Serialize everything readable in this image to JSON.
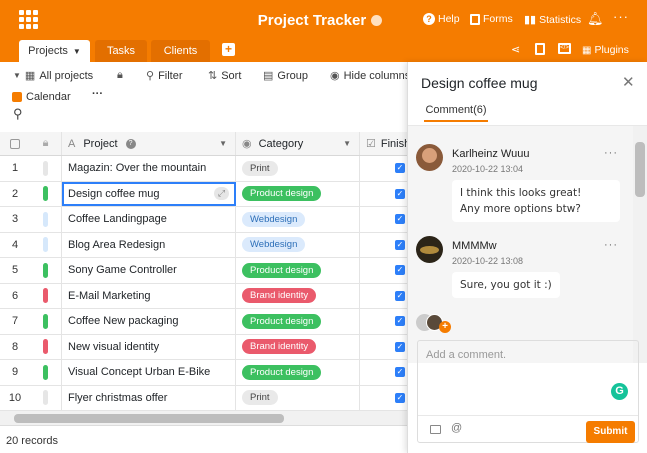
{
  "header": {
    "title": "Project Tracker",
    "help": "Help",
    "forms": "Forms",
    "statistics": "Statistics",
    "plugins": "Plugins"
  },
  "tabs": [
    {
      "label": "Projects",
      "active": true
    },
    {
      "label": "Tasks"
    },
    {
      "label": "Clients"
    }
  ],
  "toolbar": {
    "view": "All projects",
    "filter": "Filter",
    "sort": "Sort",
    "group": "Group",
    "hide": "Hide columns",
    "calendar": "Calendar",
    "more": "···"
  },
  "columns": {
    "project": "Project",
    "category": "Category",
    "finished": "Finished"
  },
  "rows": [
    {
      "n": "1",
      "name": "Magazin: Over the mountain",
      "cat": "Print",
      "bar": "#e6e6e6"
    },
    {
      "n": "2",
      "name": "Design coffee mug",
      "cat": "Product design",
      "bar": "#3cc060"
    },
    {
      "n": "3",
      "name": "Coffee Landingpage",
      "cat": "Webdesign",
      "bar": "#d6e8fb"
    },
    {
      "n": "4",
      "name": "Blog Area Redesign",
      "cat": "Webdesign",
      "bar": "#d6e8fb"
    },
    {
      "n": "5",
      "name": "Sony Game Controller",
      "cat": "Product design",
      "bar": "#3cc060"
    },
    {
      "n": "6",
      "name": "E-Mail Marketing",
      "cat": "Brand identity",
      "bar": "#ea5a6c"
    },
    {
      "n": "7",
      "name": "Coffee New packaging",
      "cat": "Product design",
      "bar": "#3cc060"
    },
    {
      "n": "8",
      "name": "New visual identity",
      "cat": "Brand identity",
      "bar": "#ea5a6c"
    },
    {
      "n": "9",
      "name": "Visual Concept Urban E-Bike",
      "cat": "Product design",
      "bar": "#3cc060"
    },
    {
      "n": "10",
      "name": "Flyer christmas offer",
      "cat": "Print",
      "bar": "#e6e6e6"
    }
  ],
  "categories": {
    "Print": {
      "bg": "#e9e9e9",
      "fg": "#444"
    },
    "Product design": {
      "bg": "#3cc060",
      "fg": "#fff"
    },
    "Webdesign": {
      "bg": "#dbeafc",
      "fg": "#2d6fb8"
    },
    "Brand identity": {
      "bg": "#ea5a6c",
      "fg": "#fff"
    }
  },
  "footer": {
    "records": "20 records"
  },
  "panel": {
    "title": "Design coffee mug",
    "tab": "Comment(6)",
    "placeholder": "Add a comment.",
    "submit": "Submit",
    "comments": [
      {
        "author": "Karlheinz Wuuu",
        "date": "2020-10-22 13:04",
        "text1": "I think this looks great!",
        "text2": "Any more options btw?"
      },
      {
        "author": "MMMMw",
        "date": "2020-10-22 13:08",
        "text1": "Sure, you got it :)"
      }
    ]
  }
}
